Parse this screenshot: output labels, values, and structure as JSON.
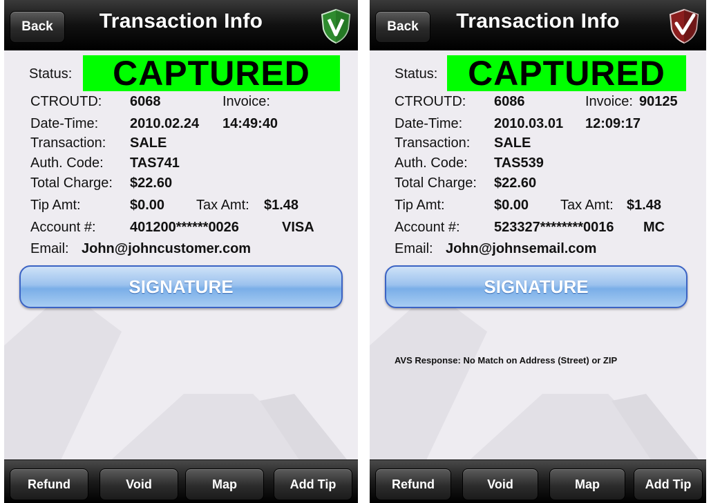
{
  "screens": [
    {
      "nav": {
        "back_label": "Back",
        "title": "Transaction Info"
      },
      "status": {
        "label": "Status:",
        "value": "CAPTURED"
      },
      "fields": {
        "ctroutd_label": "CTROUTD:",
        "ctroutd_value": "6068",
        "invoice_label": "Invoice:",
        "invoice_value": "",
        "datetime_label": "Date-Time:",
        "date_value": "2010.02.24",
        "time_value": "14:49:40",
        "transaction_label": "Transaction:",
        "transaction_value": "SALE",
        "auth_label": "Auth. Code:",
        "auth_value": "TAS741",
        "total_label": "Total Charge:",
        "total_value": "$22.60",
        "tip_label": "Tip Amt:",
        "tip_value": "$0.00",
        "tax_label": "Tax Amt:",
        "tax_value": "$1.48",
        "account_label": "Account #:",
        "account_value": "401200******0026",
        "card_type": "VISA",
        "email_label": "Email:",
        "email_value": "John@johncustomer.com"
      },
      "signature_label": "SIGNATURE",
      "avs_text": "",
      "toolbar": {
        "refund": "Refund",
        "void": "Void",
        "map": "Map",
        "add_tip": "Add Tip"
      },
      "badge_icon": "green-v-shield-icon"
    },
    {
      "nav": {
        "back_label": "Back",
        "title": "Transaction Info"
      },
      "status": {
        "label": "Status:",
        "value": "CAPTURED"
      },
      "fields": {
        "ctroutd_label": "CTROUTD:",
        "ctroutd_value": "6086",
        "invoice_label": "Invoice:",
        "invoice_value": "90125",
        "datetime_label": "Date-Time:",
        "date_value": "2010.03.01",
        "time_value": "12:09:17",
        "transaction_label": "Transaction:",
        "transaction_value": "SALE",
        "auth_label": "Auth. Code:",
        "auth_value": "TAS539",
        "total_label": "Total Charge:",
        "total_value": "$22.60",
        "tip_label": "Tip Amt:",
        "tip_value": "$0.00",
        "tax_label": "Tax Amt:",
        "tax_value": "$1.48",
        "account_label": "Account #:",
        "account_value": "523327********0016",
        "card_type": "MC",
        "email_label": "Email:",
        "email_value": "John@johnsemail.com"
      },
      "signature_label": "SIGNATURE",
      "avs_text": "AVS Response: No Match on Address (Street) or ZIP",
      "toolbar": {
        "refund": "Refund",
        "void": "Void",
        "map": "Map",
        "add_tip": "Add Tip"
      },
      "badge_icon": "red-check-shield-icon"
    }
  ],
  "colors": {
    "status_green": "#00ff00",
    "nav_black": "#000000",
    "signature_blue": "#7aaee8"
  }
}
